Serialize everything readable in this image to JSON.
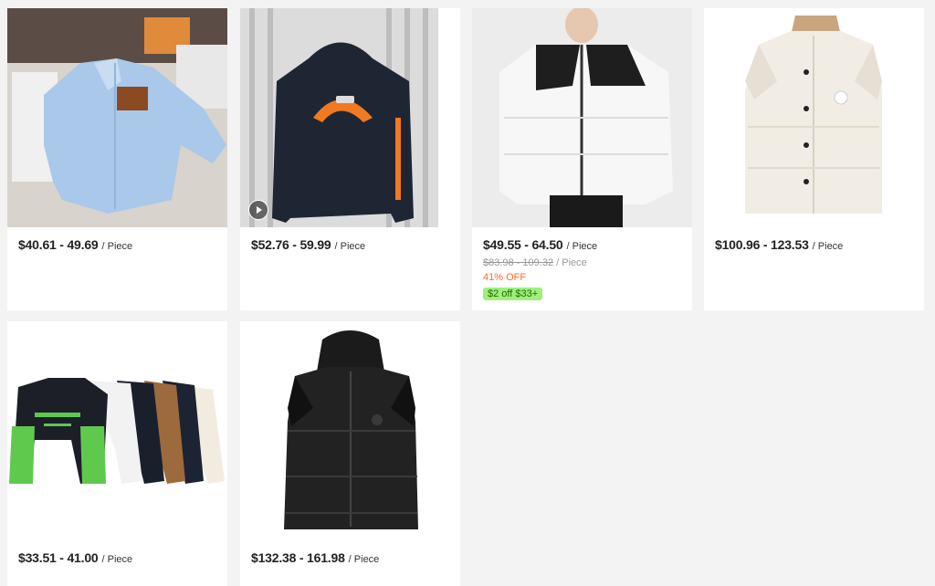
{
  "products": [
    {
      "price": "$40.61 - 49.69",
      "unit": "/ Piece",
      "image": "light-blue-shirt"
    },
    {
      "price": "$52.76 - 59.99",
      "unit": "/ Piece",
      "image": "navy-hoodie",
      "video_icon": "play-icon"
    },
    {
      "price": "$49.55 - 64.50",
      "unit": "/ Piece",
      "image": "white-black-puffer-jacket",
      "old_price": "$83.98 - 109.32",
      "old_unit": "/ Piece",
      "discount": "41% OFF",
      "coupon": "$2 off $33+"
    },
    {
      "price": "$100.96 - 123.53",
      "unit": "/ Piece",
      "image": "white-puffer-vest"
    },
    {
      "price": "$33.51 - 41.00",
      "unit": "/ Piece",
      "image": "long-sleeve-tees"
    },
    {
      "price": "$132.38 - 161.98",
      "unit": "/ Piece",
      "image": "black-puffer-vest"
    }
  ],
  "colors": {
    "discount": "#fd6d1f",
    "coupon_bg": "#9ef07a",
    "page_bg": "#f3f3f3"
  }
}
